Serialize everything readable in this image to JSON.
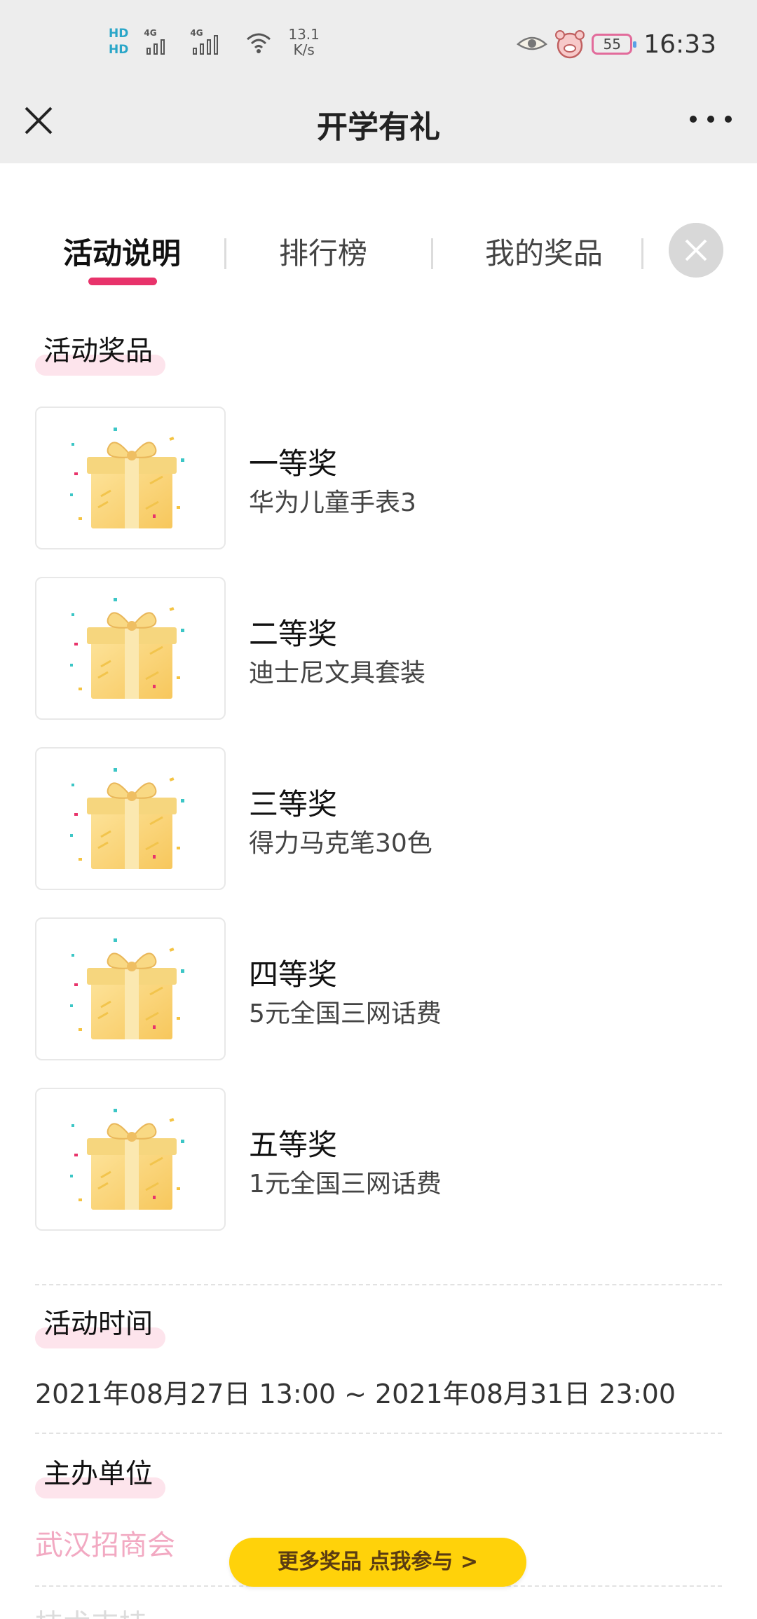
{
  "status_bar": {
    "hd_1": "HD",
    "hd_2": "HD",
    "signal_1_tag": "4G",
    "signal_2_tag": "4G",
    "net_speed_value": "13.1",
    "net_speed_unit": "K/s",
    "battery": "55",
    "time": "16:33"
  },
  "title_bar": {
    "title": "开学有礼",
    "close_icon": "close-icon",
    "more_icon": "more-dots-icon"
  },
  "tabs": [
    {
      "label": "活动说明",
      "active": true
    },
    {
      "label": "排行榜",
      "active": false
    },
    {
      "label": "我的奖品",
      "active": false
    }
  ],
  "sections": {
    "prizes_heading": "活动奖品",
    "time_heading": "活动时间",
    "organizer_heading": "主办单位",
    "next_heading_partial": "技术支持"
  },
  "prizes": [
    {
      "name": "一等奖",
      "desc": "华为儿童手表3"
    },
    {
      "name": "二等奖",
      "desc": "迪士尼文具套装"
    },
    {
      "name": "三等奖",
      "desc": "得力马克笔30色"
    },
    {
      "name": "四等奖",
      "desc": "5元全国三网话费"
    },
    {
      "name": "五等奖",
      "desc": "1元全国三网话费"
    }
  ],
  "activity_time": "2021年08月27日 13:00 ~ 2021年08月31日 23:00",
  "organizer": "武汉招商会",
  "cta_button": "更多奖品   点我参与 >",
  "colors": {
    "accent": "#e8336b",
    "cta": "#ffd20a",
    "organizer_text": "#f2a9c2",
    "heading_highlight": "#fde4ec"
  }
}
